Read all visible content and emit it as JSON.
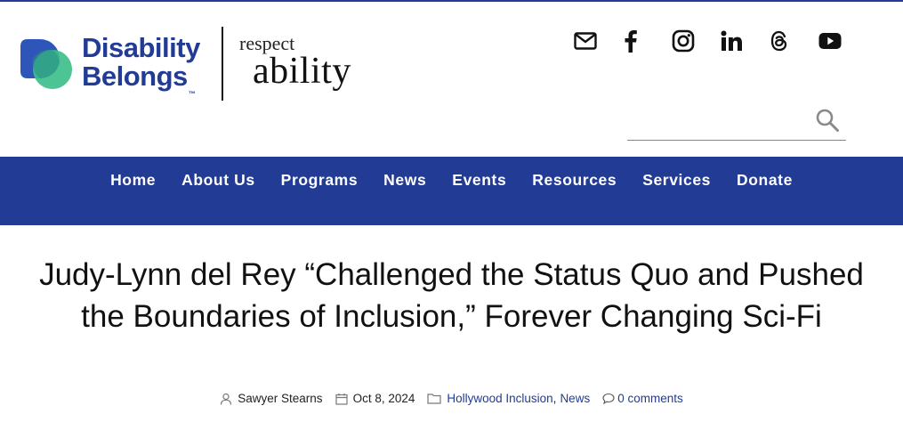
{
  "brand": {
    "line1": "Disability",
    "line2": "Belongs",
    "trademark": "™",
    "partner_top": "respect",
    "partner_bottom": "ability",
    "colors": {
      "navy": "#223c96",
      "green": "#3dbf8a",
      "blue": "#2e55b8"
    }
  },
  "social": [
    {
      "name": "email",
      "icon": "envelope-icon"
    },
    {
      "name": "facebook",
      "icon": "facebook-icon"
    },
    {
      "name": "instagram",
      "icon": "instagram-icon"
    },
    {
      "name": "linkedin",
      "icon": "linkedin-icon"
    },
    {
      "name": "threads",
      "icon": "threads-icon"
    },
    {
      "name": "youtube",
      "icon": "youtube-icon"
    }
  ],
  "search": {
    "placeholder": "",
    "value": "",
    "icon": "search-icon"
  },
  "nav": {
    "items": [
      "Home",
      "About Us",
      "Programs",
      "News",
      "Events",
      "Resources",
      "Services",
      "Donate"
    ],
    "background": "#223c96"
  },
  "article": {
    "title": "Judy-Lynn del Rey “Challenged the Status Quo and Pushed the Boundaries of Inclusion,” Forever Changing Sci-Fi",
    "author": "Sawyer Stearns",
    "date": "Oct 8, 2024",
    "category_1": "Hollywood Inclusion",
    "category_sep": ",",
    "category_2": "News",
    "comments": "0 comments"
  }
}
